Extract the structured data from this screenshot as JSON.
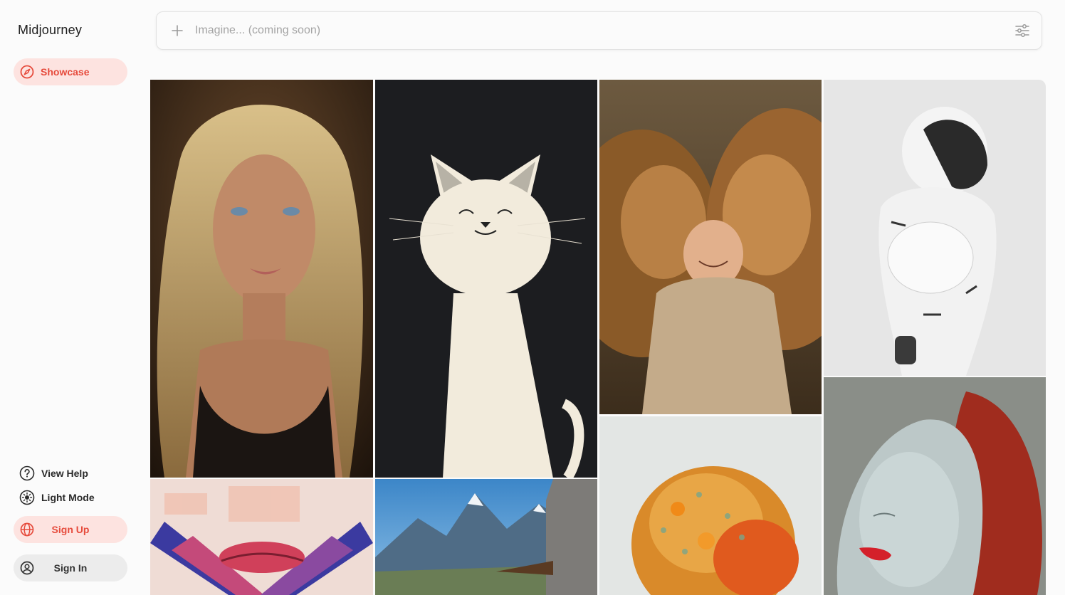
{
  "app": {
    "name": "Midjourney"
  },
  "nav": {
    "active_label": "Showcase"
  },
  "search": {
    "placeholder": "Imagine... (coming soon)"
  },
  "footer_links": {
    "help": "View Help",
    "theme": "Light Mode"
  },
  "auth": {
    "signup": "Sign Up",
    "signin": "Sign In"
  },
  "colors": {
    "accent": "#e64b3c",
    "accent_bg": "#fde3e0",
    "pill_gray": "#ececec"
  },
  "gallery": [
    {
      "name": "blonde-woman-portrait"
    },
    {
      "name": "white-cat-illustration"
    },
    {
      "name": "lions-with-baby"
    },
    {
      "name": "white-robot-figure"
    },
    {
      "name": "lips-poster-art"
    },
    {
      "name": "mountain-landscape"
    },
    {
      "name": "golden-jeweled-creature"
    },
    {
      "name": "glossy-faces-sculpture"
    }
  ]
}
